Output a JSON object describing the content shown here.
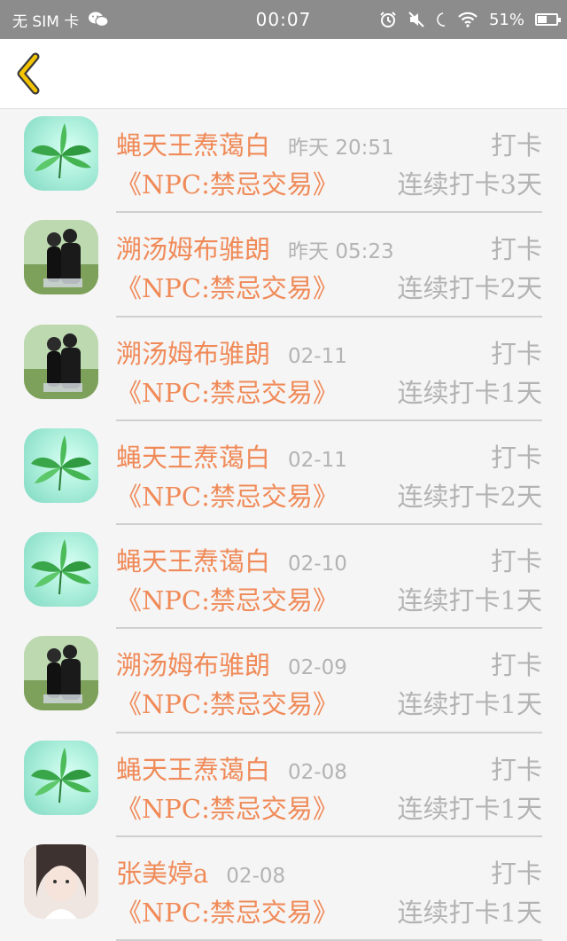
{
  "status_bar": {
    "carrier": "无 SIM 卡",
    "time": "00:07",
    "battery": "51%",
    "battery_level": 0.51
  },
  "colors": {
    "accent": "#f08a58",
    "muted": "#b3b3b3",
    "statusbar": "#8c8c8c"
  },
  "list": [
    {
      "avatar": "leaf-avatar",
      "name": "蝇天王焘蔼白",
      "time": "昨天 20:51",
      "action": "打卡",
      "title": "《NPC:禁忌交易》",
      "streak": "连续打卡3天"
    },
    {
      "avatar": "couple-avatar",
      "name": "溯汤姆布骓朗",
      "time": "昨天 05:23",
      "action": "打卡",
      "title": "《NPC:禁忌交易》",
      "streak": "连续打卡2天"
    },
    {
      "avatar": "couple-avatar",
      "name": "溯汤姆布骓朗",
      "time": "02-11",
      "action": "打卡",
      "title": "《NPC:禁忌交易》",
      "streak": "连续打卡1天"
    },
    {
      "avatar": "leaf-avatar",
      "name": "蝇天王焘蔼白",
      "time": "02-11",
      "action": "打卡",
      "title": "《NPC:禁忌交易》",
      "streak": "连续打卡2天"
    },
    {
      "avatar": "leaf-avatar",
      "name": "蝇天王焘蔼白",
      "time": "02-10",
      "action": "打卡",
      "title": "《NPC:禁忌交易》",
      "streak": "连续打卡1天"
    },
    {
      "avatar": "couple-avatar",
      "name": "溯汤姆布骓朗",
      "time": "02-09",
      "action": "打卡",
      "title": "《NPC:禁忌交易》",
      "streak": "连续打卡1天"
    },
    {
      "avatar": "leaf-avatar",
      "name": "蝇天王焘蔼白",
      "time": "02-08",
      "action": "打卡",
      "title": "《NPC:禁忌交易》",
      "streak": "连续打卡1天"
    },
    {
      "avatar": "girl-avatar",
      "name": "张美婷a",
      "time": "02-08",
      "action": "打卡",
      "title": "《NPC:禁忌交易》",
      "streak": "连续打卡1天"
    }
  ]
}
